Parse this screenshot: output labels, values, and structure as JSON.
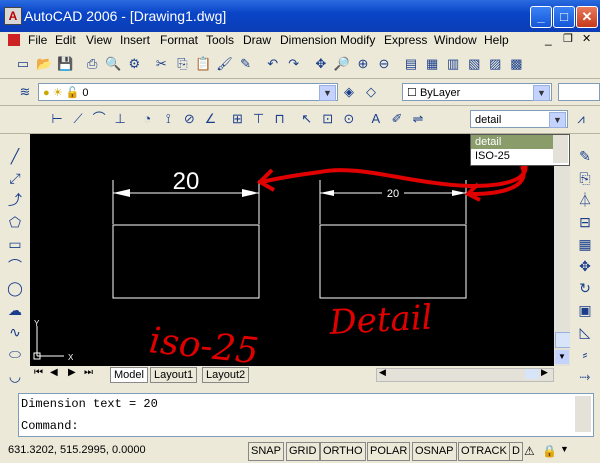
{
  "window": {
    "title": "AutoCAD 2006 - [Drawing1.dwg]",
    "app_icon": "A"
  },
  "menu": [
    "File",
    "Edit",
    "View",
    "Insert",
    "Format",
    "Tools",
    "Draw",
    "Dimension",
    "Modify",
    "Express",
    "Window",
    "Help"
  ],
  "layer": {
    "current": "0"
  },
  "properties": {
    "color": "ByLayer"
  },
  "dimstyle": {
    "current": "detail",
    "options": [
      "detail",
      "ISO-25"
    ]
  },
  "drawing": {
    "dim_left": "20",
    "dim_right": "20",
    "annotation_left": "iso-25",
    "annotation_right": "Detail",
    "ucs_x": "X",
    "ucs_y": "Y"
  },
  "tabs": [
    "Model",
    "Layout1",
    "Layout2"
  ],
  "command": {
    "history": "Dimension text = 20",
    "prompt": "Command:"
  },
  "status": {
    "coords": "631.3202, 515.2995, 0.0000",
    "toggles": [
      "SNAP",
      "GRID",
      "ORTHO",
      "POLAR",
      "OSNAP",
      "OTRACK",
      "D"
    ]
  },
  "colors": {
    "annotation": "#e00000",
    "title_bar": "#0a45c8",
    "canvas": "#000000"
  }
}
